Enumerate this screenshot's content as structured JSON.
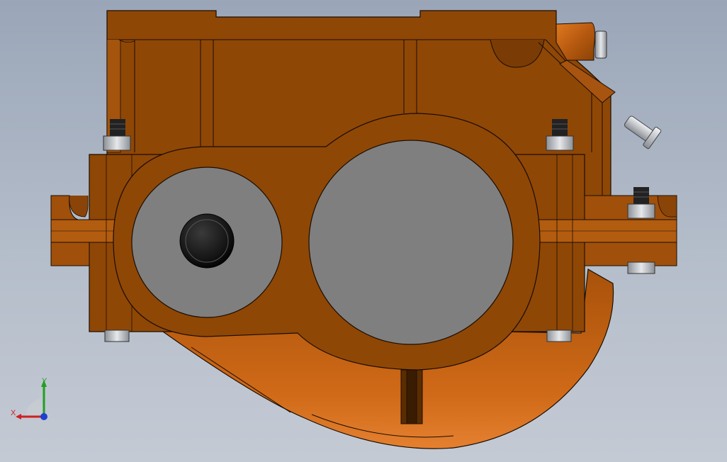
{
  "viewport": {
    "background_top": "#9aa6b8",
    "background_bottom": "#c4cad4"
  },
  "model": {
    "body_color": "#8f4706",
    "body_dark": "#6e3604",
    "body_light": "#c8641a",
    "edge_color": "#1a0d02",
    "bore_color": "#7f7f7f",
    "seal_cap_color": "#1c1c1c",
    "bolt_color": "#b8bcc0",
    "parts": [
      "gearbox-housing",
      "output-bore",
      "input-bore",
      "seal-cap",
      "dipstick",
      "breather-plug",
      "bolts"
    ]
  },
  "triad": {
    "x_label": "X",
    "y_label": "Y",
    "x_color": "#d02020",
    "y_color": "#20a020",
    "z_color": "#2040d0"
  }
}
